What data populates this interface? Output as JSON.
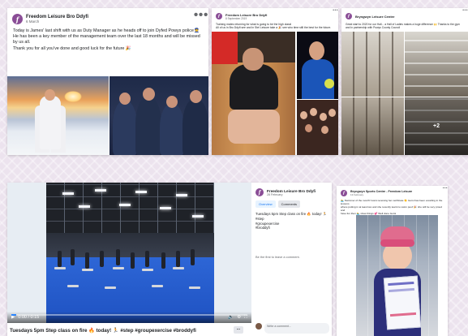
{
  "post1": {
    "page_name": "Freedom Leisure Bro Ddyfi",
    "date": "6 March",
    "text_lines": [
      "Today is James' last shift with us as Duty Manager as he heads off to join Dyfed Powys police👮",
      "He has been a key member of the management team over the last 18 months and will be missed",
      "by us all.",
      "Thank you for all you've done and good luck for the future 🎉"
    ]
  },
  "post2": {
    "page_name": "Freedom Leisure Bro Ddyfi",
    "date": "8 September 2019",
    "text_lines": [
      "Training mates returning for what is going to be the high class!",
      "All of us in Bro Ddyfi see and in Stel Leisure take a 🎉 see who time still the best for the future."
    ]
  },
  "post3": {
    "page_name": "Bryngwyn Leisure Centre",
    "date": "",
    "text_lines": [
      "Great start to 2020 for our Hall... a Hall of Ladies makes a huge difference 🙌 Thanks to the gym",
      "and in partnership with Powys County Council"
    ],
    "more_photos": "+2"
  },
  "video_post": {
    "page_name": "Freedom Leisure Bro Ddyfi",
    "date": "28 February",
    "tabs": [
      "Overview",
      "Comments"
    ],
    "caption": "Tuesdays 5pm Step class on fire 🔥 today! 🏃",
    "hashtags": [
      "#step",
      "#groupexercise",
      "#broddyfi"
    ],
    "first_comment": "Be the first to leave a comment.",
    "comment_placeholder": "Write a comment...",
    "video_caption": "Tuesdays 5pm Step class on fire 🔥 today! 🏃 #step #groupexercise #broddyfi",
    "time": "0:00 / 0:15",
    "progress": 0.02,
    "more_button": "...",
    "colors": {
      "accent": "#1877f2",
      "floor": "#2d66d6"
    }
  },
  "post5": {
    "page_name": "Bryngwyn Sports Centre - Freedom Leisure",
    "date": "13 February",
    "text_lines": [
      "🏊 Swimmer of the month! Gorsi receiving her certificate 👏 Gorsi has been excelling in the lessons",
      "where putting in at least two and she recently learnt to swim pool! 🎉 she will be very proud and",
      "have fun then 🏊 show things 💕 Well done Gorsi"
    ]
  },
  "icons": [
    "page-logo-icon",
    "more-options-icon",
    "play-icon",
    "volume-icon",
    "settings-icon",
    "fullscreen-icon"
  ],
  "colors": {
    "brand_purple": "#8a4d96",
    "background": "#ece3ee"
  }
}
